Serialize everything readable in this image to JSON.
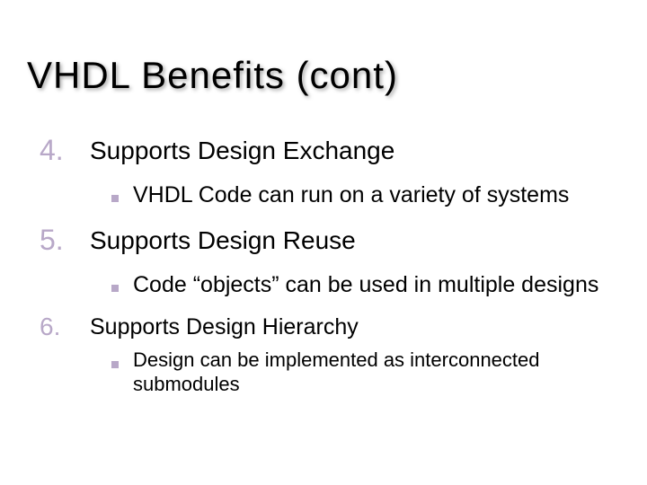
{
  "title": "VHDL  Benefits  (cont)",
  "items": [
    {
      "number": "4.",
      "text": "Supports Design Exchange",
      "subs": [
        {
          "text": "VHDL Code can run on a variety of systems"
        }
      ]
    },
    {
      "number": "5.",
      "text": "Supports Design Reuse",
      "subs": [
        {
          "text": "Code “objects” can be used in multiple designs"
        }
      ]
    },
    {
      "number": "6.",
      "text": "Supports Design Hierarchy",
      "subs": [
        {
          "text": "Design can be implemented as interconnected submodules"
        }
      ]
    }
  ]
}
